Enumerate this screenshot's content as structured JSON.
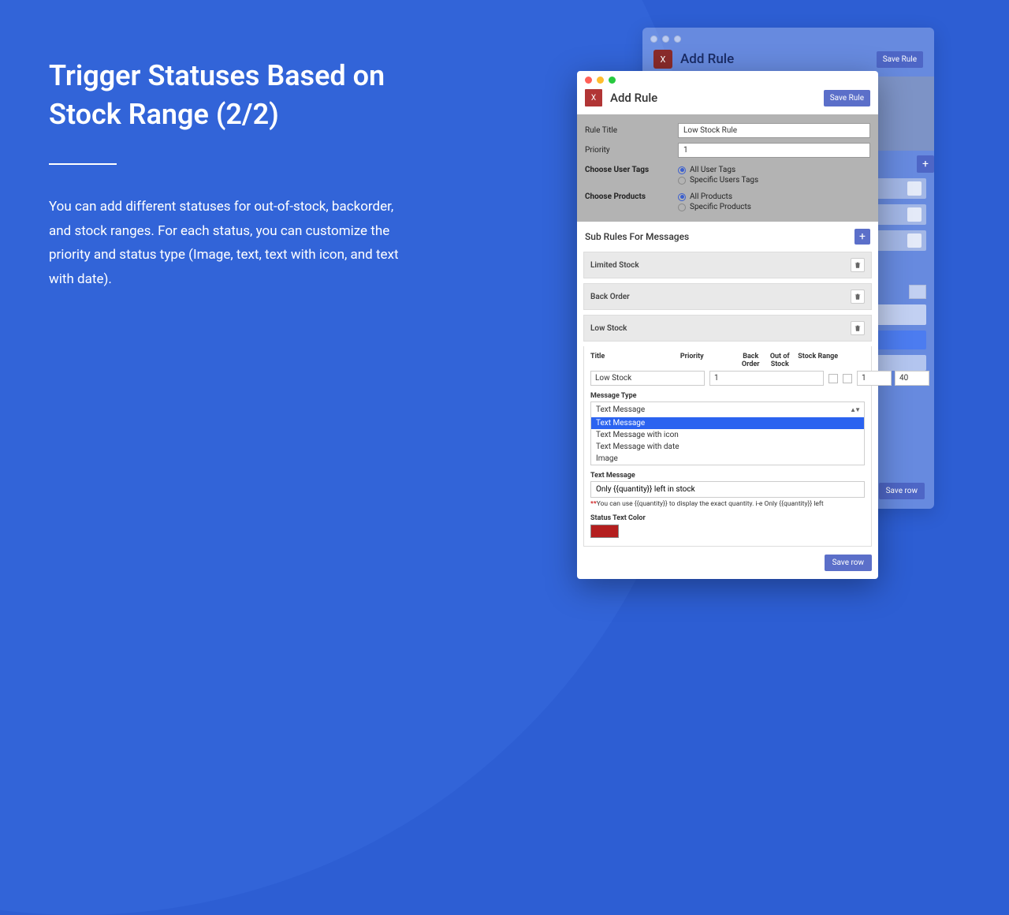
{
  "hero": {
    "headline": "Trigger Statuses Based on Stock Range (2/2)",
    "body": "You can add different statuses for out-of-stock, backorder, and stock ranges. For each status, you can customize the priority and status type (Image, text, text with icon, and text with date)."
  },
  "back_window": {
    "close": "X",
    "title": "Add Rule",
    "save": "Save Rule",
    "plus": "+",
    "save_row": "Save row"
  },
  "window": {
    "close": "X",
    "title": "Add Rule",
    "save": "Save Rule"
  },
  "form": {
    "rule_title_label": "Rule Title",
    "rule_title_value": "Low Stock Rule",
    "priority_label": "Priority",
    "priority_value": "1",
    "user_tags_label": "Choose User Tags",
    "user_tags_opts": [
      "All User Tags",
      "Specific Users Tags"
    ],
    "products_label": "Choose Products",
    "products_opts": [
      "All Products",
      "Specific Products"
    ]
  },
  "subrules": {
    "header": "Sub Rules For Messages",
    "plus": "+",
    "items": [
      "Limited Stock",
      "Back Order",
      "Low Stock"
    ]
  },
  "detail": {
    "cols": {
      "title": "Title",
      "priority": "Priority",
      "back_order": "Back Order",
      "out_of_stock": "Out of Stock",
      "stock_range": "Stock Range"
    },
    "title_value": "Low Stock",
    "priority_value": "1",
    "stock_range_from": "1",
    "stock_range_to": "40"
  },
  "message_type": {
    "label": "Message Type",
    "selected": "Text Message",
    "options": [
      "Text Message",
      "Text Message with icon",
      "Text Message with date",
      "Image"
    ]
  },
  "text_message": {
    "label": "Text Message",
    "value": "Only {{quantity}} left in stock",
    "hint_prefix": "**",
    "hint_body": "You can use {{quantity}} to display the exact quantity. i-e Only {{quantity}} left"
  },
  "status_color": {
    "label": "Status Text Color",
    "value": "#b41f1f"
  },
  "save_row": "Save row"
}
